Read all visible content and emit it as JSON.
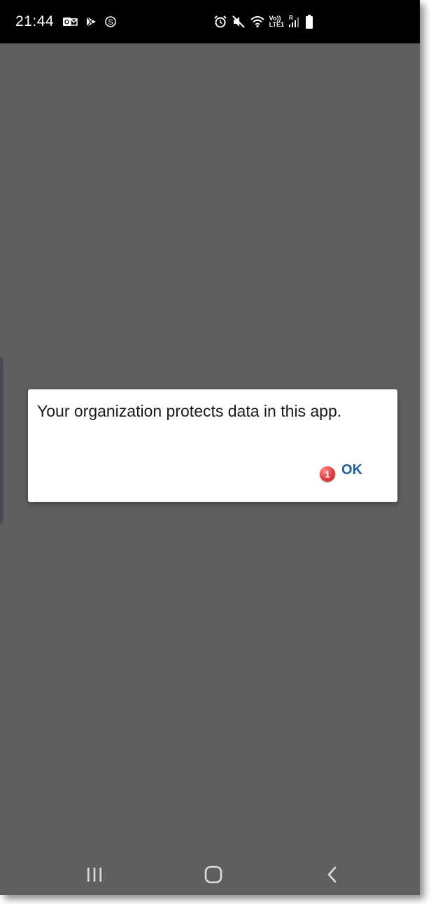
{
  "status_bar": {
    "time": "21:44",
    "left_icons": [
      "outlook-icon",
      "play-store-icon",
      "skype-icon"
    ],
    "right_icons": [
      "alarm-icon",
      "mute-icon",
      "wifi-icon",
      "volte-icon",
      "signal-icon",
      "battery-icon"
    ],
    "volte_label": "Vo))",
    "lte_label": "LTE1",
    "roaming_label": "R"
  },
  "dialog": {
    "message": "Your organization protects data in this app.",
    "ok_label": "OK",
    "step_badge": "1"
  },
  "nav_bar": {
    "buttons": [
      "recents-icon",
      "home-icon",
      "back-icon"
    ]
  },
  "colors": {
    "background": "#5f5f5f",
    "status_bar": "#000000",
    "dialog": "#ffffff",
    "accent": "#1e5fa0",
    "badge": "#e03a3a"
  }
}
